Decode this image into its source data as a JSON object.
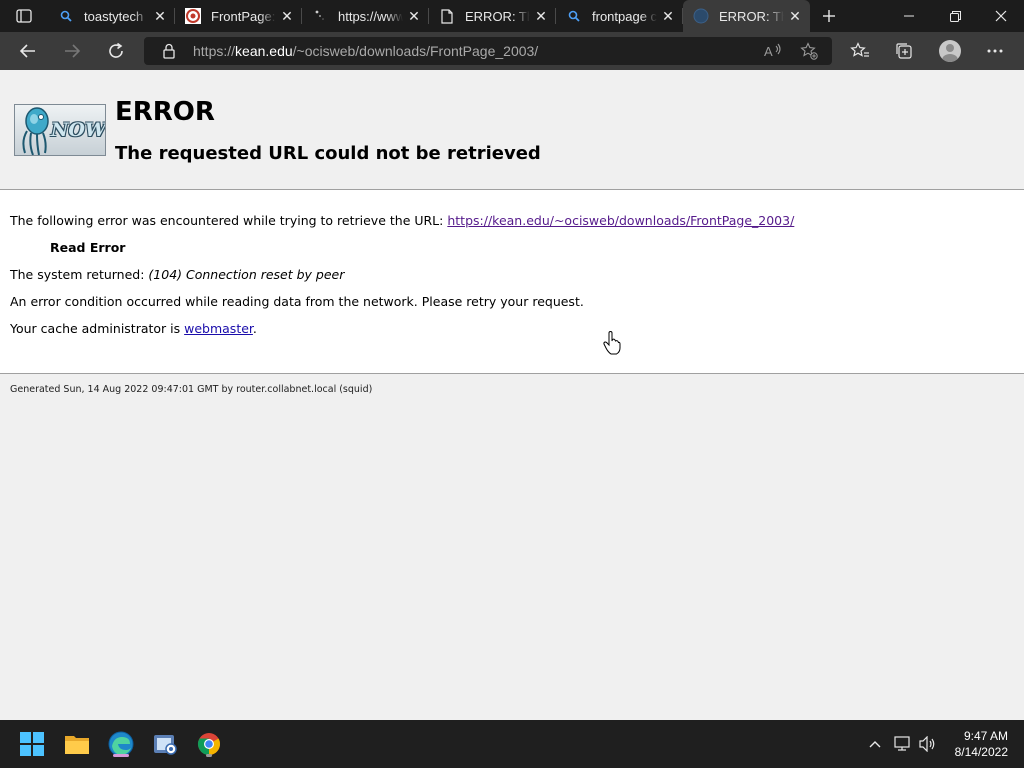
{
  "browser": {
    "tabs": [
      {
        "title": "toastytech",
        "icon": "search-icon",
        "active": false
      },
      {
        "title": "FrontPage:",
        "icon": "site-favicon-icon",
        "active": false
      },
      {
        "title": "https://www",
        "icon": "loading-icon",
        "active": false
      },
      {
        "title": "ERROR: The",
        "icon": "page-icon",
        "active": false
      },
      {
        "title": "frontpage c",
        "icon": "search-icon",
        "active": false
      },
      {
        "title": "ERROR: The",
        "icon": "globe-icon",
        "active": true
      }
    ],
    "address": {
      "scheme": "https://",
      "host": "kean.edu",
      "path": "/~ocisweb/downloads/FrontPage_2003/"
    }
  },
  "page": {
    "logo_text": "NOW",
    "title": "ERROR",
    "subtitle": "The requested URL could not be retrieved",
    "intro_text": "The following error was encountered while trying to retrieve the URL: ",
    "url_link": "https://kean.edu/~ocisweb/downloads/FrontPage_2003/",
    "error_name": "Read Error",
    "system_prefix": "The system returned: ",
    "system_error": "(104) Connection reset by peer",
    "description": "An error condition occurred while reading data from the network. Please retry your request.",
    "admin_prefix": "Your cache administrator is ",
    "admin_link": "webmaster",
    "admin_suffix": ".",
    "footer": "Generated Sun, 14 Aug 2022 09:47:01 GMT by router.collabnet.local (squid)"
  },
  "taskbar": {
    "apps": [
      {
        "name": "start-button",
        "icon": "windows-logo-icon"
      },
      {
        "name": "file-explorer",
        "icon": "folder-icon"
      },
      {
        "name": "edge",
        "icon": "edge-icon",
        "active": true
      },
      {
        "name": "photos",
        "icon": "photos-icon"
      },
      {
        "name": "chrome",
        "icon": "chrome-icon"
      }
    ],
    "time": "9:47 AM",
    "date": "8/14/2022"
  },
  "colors": {
    "tabbar_bg": "#1c1c1c",
    "toolbar_bg": "#3b3b3b",
    "page_bg": "#f0f0f0",
    "content_bg": "#ffffff",
    "taskbar_bg": "#1f1f1f",
    "visited_link": "#551a8b",
    "link": "#1a0dab"
  }
}
